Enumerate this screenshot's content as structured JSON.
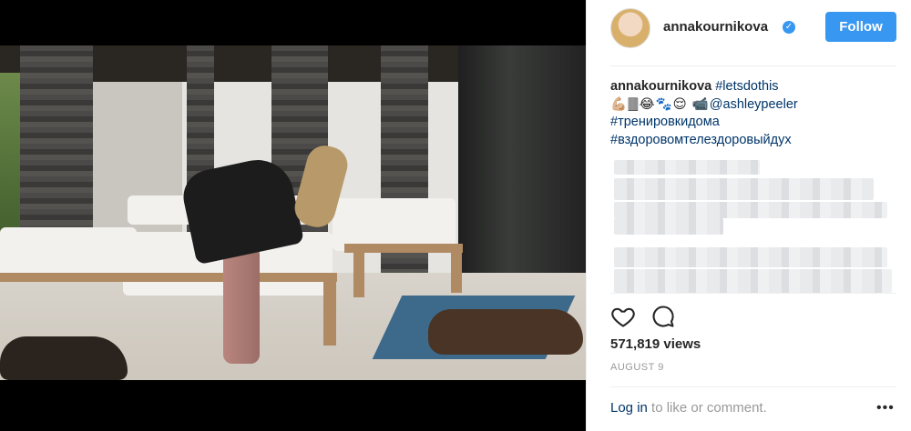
{
  "post": {
    "username": "annakournikova",
    "verified_mark": "✓",
    "follow_label": "Follow",
    "caption": {
      "username": "annakournikova",
      "hashtag1": "#letsdothis",
      "emojis": "💪🏼🀫😂🐾😌 📹",
      "mention": "@ashleypeeler",
      "hashtag2": "#тренировкидома",
      "hashtag3": "#вздоровомтелездоровыйдух"
    },
    "views": "571,819 views",
    "date": "AUGUST 9",
    "login_link": "Log in",
    "login_suffix": " to like or comment.",
    "more_label": "•••",
    "icons": {
      "like": "heart-icon",
      "comment": "comment-icon",
      "verified": "verified-badge-icon",
      "more": "more-options-icon"
    },
    "colors": {
      "accent": "#3897f0",
      "link": "#003569",
      "muted": "#999999"
    }
  }
}
